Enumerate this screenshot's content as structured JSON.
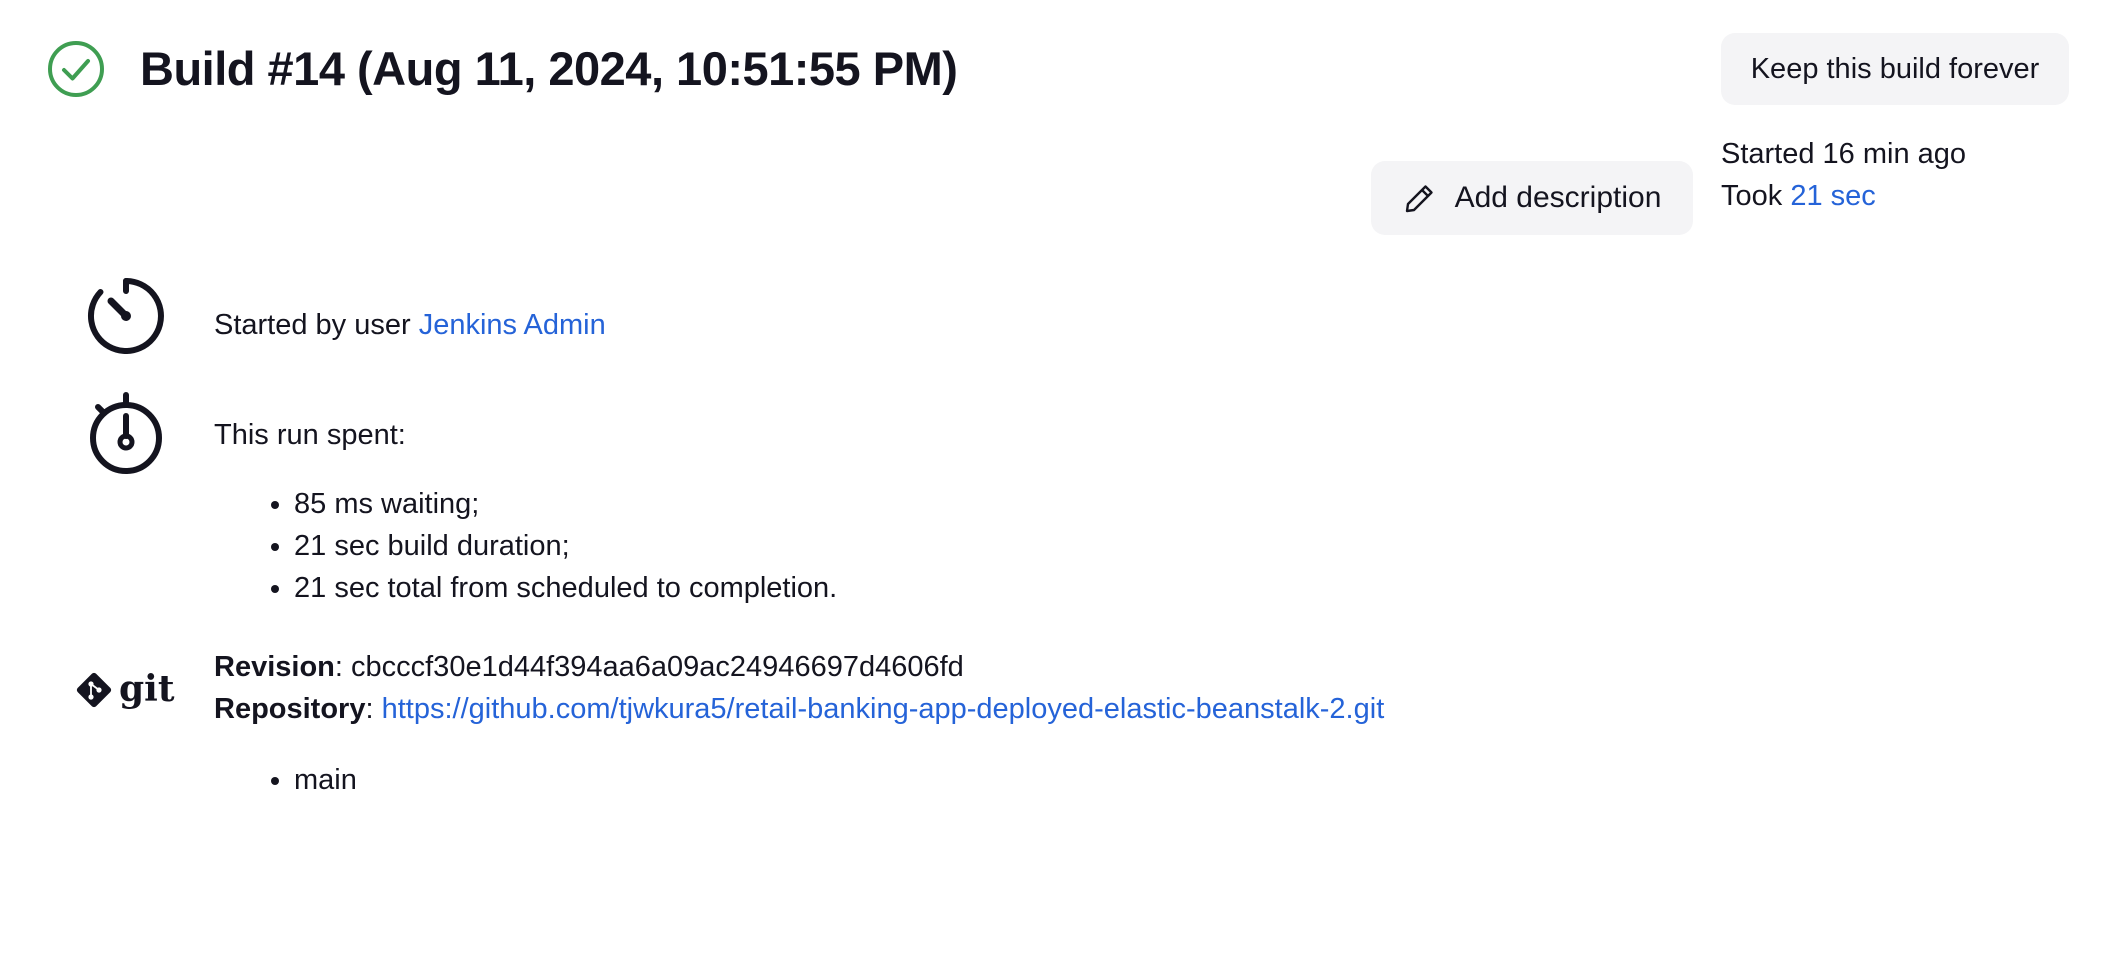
{
  "header": {
    "title": "Build #14 (Aug 11, 2024, 10:51:55 PM)",
    "status_icon": "success-check-circle-icon",
    "status_color": "#3f9e52",
    "keep_button_label": "Keep this build forever",
    "add_description_label": "Add description",
    "started": "Started 16 min ago",
    "took_prefix": "Took",
    "took_value": "21 sec"
  },
  "cause": {
    "icon": "speedometer-icon",
    "prefix": "Started by user",
    "user": "Jenkins Admin"
  },
  "timing": {
    "icon": "stopwatch-icon",
    "heading": "This run spent:",
    "items": [
      "85 ms waiting;",
      "21 sec build duration;",
      "21 sec total from scheduled to completion."
    ]
  },
  "git": {
    "icon": "git-logo-icon",
    "logo_text": "git",
    "revision_label": "Revision",
    "revision": "cbcccf30e1d44f394aa6a09ac24946697d4606fd",
    "repository_label": "Repository",
    "repository": "https://github.com/tjwkura5/retail-banking-app-deployed-elastic-beanstalk-2.git",
    "branches": [
      "main"
    ]
  },
  "colors": {
    "link": "#2563d8",
    "text": "#14141f",
    "button_bg": "#f4f4f6"
  }
}
